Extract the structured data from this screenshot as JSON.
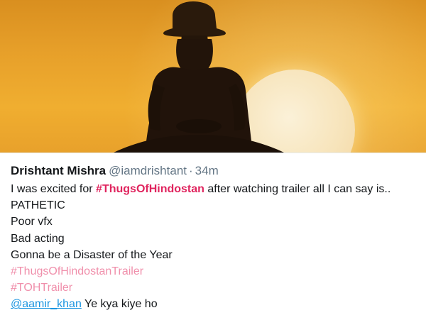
{
  "media": {
    "description_icon": "photo-icon"
  },
  "tweet": {
    "display_name": "Drishtant Mishra",
    "handle": "@iamdrishtant",
    "separator": "·",
    "time": "34m",
    "line1_prefix": "I was excited for ",
    "line1_hashtag": "#ThugsOfHindostan",
    "line1_suffix": " after watching trailer all I can say is..",
    "line2": "PATHETIC",
    "line3": "Poor vfx",
    "line4": "Bad acting",
    "line5": "Gonna be a Disaster of the Year",
    "hashtag2": "#ThugsOfHindostanTrailer",
    "hashtag3": "#TOHTrailer",
    "mention": "@aamir_khan",
    "mention_suffix": " Ye kya kiye ho"
  },
  "colors": {
    "hashtag": "#e0245e",
    "hashtag_light": "#f08fab",
    "mention": "#1b95e0",
    "text": "#14171a",
    "muted": "#657786"
  }
}
